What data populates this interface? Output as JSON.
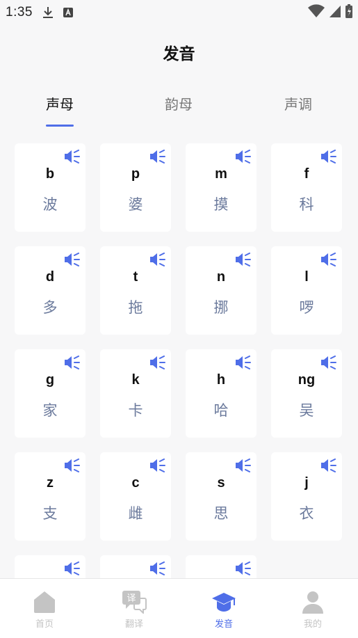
{
  "status_bar": {
    "time": "1:35"
  },
  "header": {
    "title": "发音"
  },
  "tabs": [
    {
      "label": "声母",
      "active": true
    },
    {
      "label": "韵母",
      "active": false
    },
    {
      "label": "声调",
      "active": false
    }
  ],
  "cards": [
    {
      "letter": "b",
      "hanzi": "波"
    },
    {
      "letter": "p",
      "hanzi": "婆"
    },
    {
      "letter": "m",
      "hanzi": "摸"
    },
    {
      "letter": "f",
      "hanzi": "科"
    },
    {
      "letter": "d",
      "hanzi": "多"
    },
    {
      "letter": "t",
      "hanzi": "拖"
    },
    {
      "letter": "n",
      "hanzi": "挪"
    },
    {
      "letter": "l",
      "hanzi": "啰"
    },
    {
      "letter": "g",
      "hanzi": "家"
    },
    {
      "letter": "k",
      "hanzi": "卡"
    },
    {
      "letter": "h",
      "hanzi": "哈"
    },
    {
      "letter": "ng",
      "hanzi": "吴"
    },
    {
      "letter": "z",
      "hanzi": "支"
    },
    {
      "letter": "c",
      "hanzi": "雌"
    },
    {
      "letter": "s",
      "hanzi": "思"
    },
    {
      "letter": "j",
      "hanzi": "衣"
    },
    {
      "letter": "",
      "hanzi": ""
    },
    {
      "letter": "",
      "hanzi": ""
    },
    {
      "letter": "",
      "hanzi": ""
    }
  ],
  "bottom_nav": [
    {
      "label": "首页",
      "icon": "home-icon",
      "active": false
    },
    {
      "label": "翻译",
      "icon": "translate-icon",
      "icon_text": "译",
      "active": false
    },
    {
      "label": "发音",
      "icon": "graduation-cap-icon",
      "active": true
    },
    {
      "label": "我的",
      "icon": "person-icon",
      "active": false
    }
  ],
  "colors": {
    "accent": "#4f6ee8",
    "hanzi": "#6b7a9c",
    "inactive_nav": "#c4c4c4",
    "background": "#f7f7f8"
  }
}
